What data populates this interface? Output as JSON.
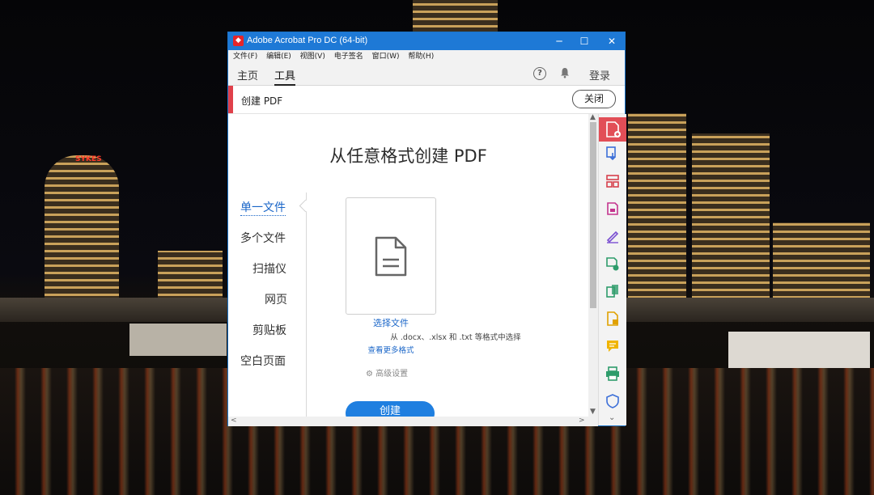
{
  "window": {
    "title": "Adobe Acrobat Pro DC (64-bit)",
    "app_icon": "acrobat-icon",
    "controls": {
      "minimize": "─",
      "maximize": "☐",
      "close": "✕"
    }
  },
  "menu": [
    "文件(F)",
    "编辑(E)",
    "视图(V)",
    "电子签名",
    "窗口(W)",
    "帮助(H)"
  ],
  "tabs": {
    "home": "主页",
    "tools": "工具",
    "active": "工具"
  },
  "topbar": {
    "help": "?",
    "login": "登录"
  },
  "toolbar": {
    "title": "创建 PDF",
    "close": "关闭"
  },
  "main": {
    "heading": "从任意格式创建 PDF",
    "nav": [
      "单一文件",
      "多个文件",
      "扫描仪",
      "网页",
      "剪贴板",
      "空白页面"
    ],
    "nav_selected": "单一文件",
    "select_file": "选择文件",
    "hint": "从 .docx、.xlsx 和 .txt 等格式中选择",
    "more_formats": "查看更多格式",
    "advanced": "高级设置",
    "create": "创建"
  },
  "right_rail_icons": [
    "create-pdf-icon",
    "export-pdf-icon",
    "organize-pages-icon",
    "edit-pdf-icon",
    "fill-sign-icon",
    "send-signature-icon",
    "compress-pdf-icon",
    "comment-file-icon",
    "comment-icon",
    "print-production-icon",
    "protect-icon"
  ],
  "colors": {
    "titlebar": "#1e79d6",
    "accent": "#e24e57",
    "link": "#1a66c8",
    "button": "#1f7fe0"
  }
}
